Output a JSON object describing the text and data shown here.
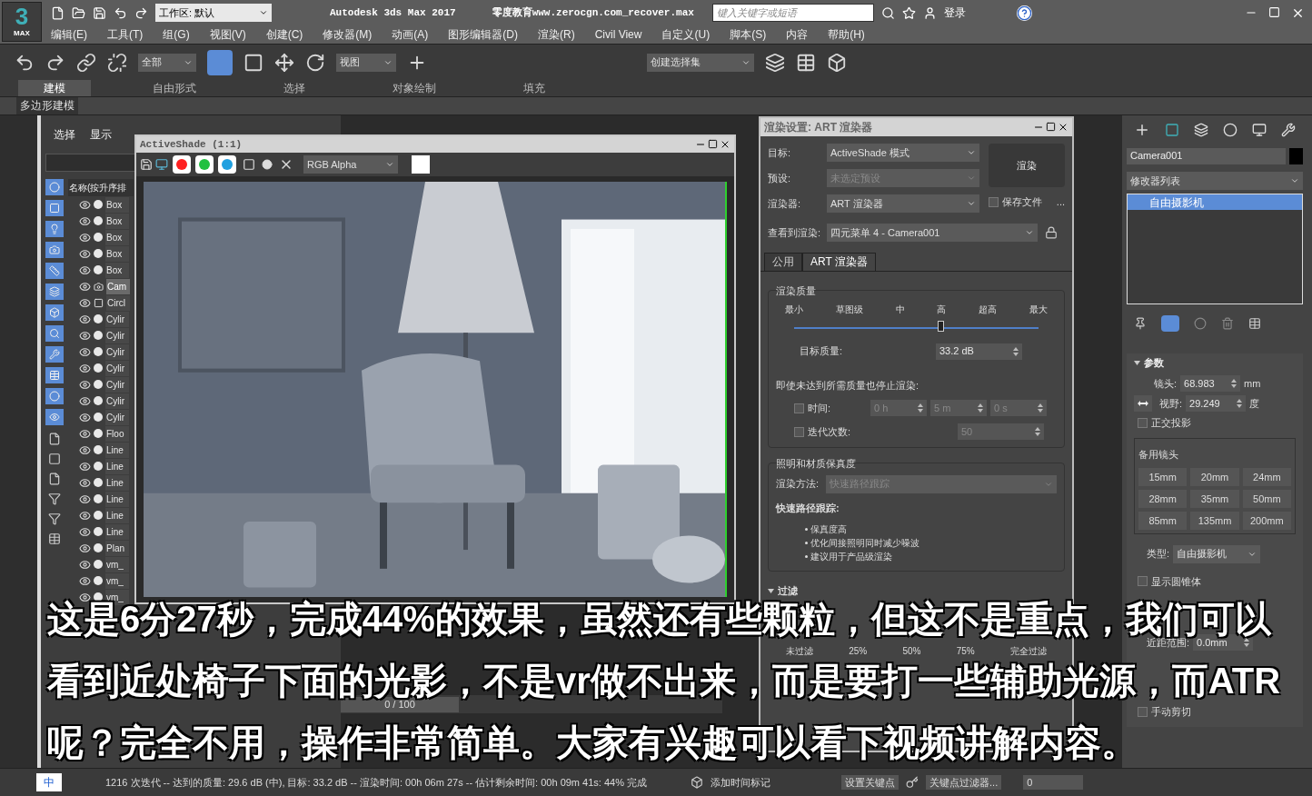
{
  "app": {
    "logo": "3",
    "logo_sub": "MAX",
    "workspace": "工作区: 默认",
    "title": "Autodesk 3ds Max 2017",
    "file": "零度教育www.zerocgn.com_recover.max",
    "search_placeholder": "键入关键字或短语",
    "login": "登录"
  },
  "menu": [
    "编辑(E)",
    "工具(T)",
    "组(G)",
    "视图(V)",
    "创建(C)",
    "修改器(M)",
    "动画(A)",
    "图形编辑器(D)",
    "渲染(R)",
    "Civil View",
    "自定义(U)",
    "脚本(S)",
    "内容",
    "帮助(H)"
  ],
  "toolbar": {
    "filter": "全部",
    "coord": "视图",
    "selection_set": "创建选择集"
  },
  "ribbon": {
    "tabs": [
      {
        "label": "建模",
        "selected": true
      },
      {
        "label": "自由形式",
        "selected": false
      },
      {
        "label": "选择",
        "selected": false
      },
      {
        "label": "对象绘制",
        "selected": false
      },
      {
        "label": "填充",
        "selected": false
      }
    ],
    "panel": "多边形建模"
  },
  "explorer": {
    "menu": [
      "选择",
      "显示"
    ],
    "header": "名称(按升序排",
    "rows": [
      {
        "name": "Box",
        "kind": "geometry",
        "selected": false
      },
      {
        "name": "Box",
        "kind": "geometry",
        "selected": false
      },
      {
        "name": "Box",
        "kind": "geometry",
        "selected": false
      },
      {
        "name": "Box",
        "kind": "geometry",
        "selected": false
      },
      {
        "name": "Box",
        "kind": "geometry",
        "selected": false
      },
      {
        "name": "Cam",
        "kind": "camera",
        "selected": true
      },
      {
        "name": "Circl",
        "kind": "shape",
        "selected": false
      },
      {
        "name": "Cylir",
        "kind": "geometry",
        "selected": false
      },
      {
        "name": "Cylir",
        "kind": "geometry",
        "selected": false
      },
      {
        "name": "Cylir",
        "kind": "geometry",
        "selected": false
      },
      {
        "name": "Cylir",
        "kind": "geometry",
        "selected": false
      },
      {
        "name": "Cylir",
        "kind": "geometry",
        "selected": false
      },
      {
        "name": "Cylir",
        "kind": "geometry",
        "selected": false
      },
      {
        "name": "Cylir",
        "kind": "geometry",
        "selected": false
      },
      {
        "name": "Floo",
        "kind": "geometry",
        "selected": false
      },
      {
        "name": "Line",
        "kind": "geometry",
        "selected": false
      },
      {
        "name": "Line",
        "kind": "geometry",
        "selected": false
      },
      {
        "name": "Line",
        "kind": "geometry",
        "selected": false
      },
      {
        "name": "Line",
        "kind": "geometry",
        "selected": false
      },
      {
        "name": "Line",
        "kind": "geometry",
        "selected": false
      },
      {
        "name": "Line",
        "kind": "geometry",
        "selected": false
      },
      {
        "name": "Plan",
        "kind": "geometry",
        "selected": false
      },
      {
        "name": "vm_",
        "kind": "geometry",
        "selected": false
      },
      {
        "name": "vm_",
        "kind": "geometry",
        "selected": false
      },
      {
        "name": "vm_",
        "kind": "geometry",
        "selected": false
      }
    ]
  },
  "activeshade": {
    "title": "ActiveShade (1:1)",
    "channel": "RGB Alpha",
    "channels": [
      {
        "color": "#ff2020"
      },
      {
        "color": "#20c040"
      },
      {
        "color": "#20a0e0"
      }
    ]
  },
  "render_settings": {
    "title": "渲染设置: ART 渲染器",
    "fields": [
      {
        "label": "目标:",
        "value": "ActiveShade 模式",
        "disabled": false
      },
      {
        "label": "预设:",
        "value": "未选定预设",
        "disabled": true
      },
      {
        "label": "渲染器:",
        "value": "ART 渲染器",
        "disabled": false
      }
    ],
    "render_button": "渲染",
    "save_file": {
      "label": "保存文件",
      "checked": false
    },
    "more": "...",
    "view": {
      "label": "查看到渲染:",
      "value": "四元菜单 4 - Camera001"
    },
    "tabs": [
      {
        "label": "公用",
        "selected": false
      },
      {
        "label": "ART 渲染器",
        "selected": true
      }
    ],
    "quality": {
      "title": "渲染质量",
      "ticks": [
        "最小",
        "草图级",
        "中",
        "高",
        "超高",
        "最大"
      ],
      "level": 0.6,
      "target_label": "目标质量:",
      "target": "33.2 dB"
    },
    "stop": {
      "label": "即使未达到所需质量也停止渲染:",
      "time": {
        "label": "时间:",
        "checked": false,
        "values": [
          "0 h",
          "5 m",
          "0 s"
        ]
      },
      "iterations": {
        "label": "迭代次数:",
        "checked": false,
        "value": "50"
      }
    },
    "fidelity": {
      "title": "照明和材质保真度",
      "method_label": "渲染方法:",
      "method": "快速路径跟踪",
      "heading": "快速路径跟踪:",
      "bullets": [
        "保真度高",
        "优化间接照明同时减少噪波",
        "建议用于产品级渲染"
      ]
    },
    "filter": {
      "title": "过滤",
      "ticks": [
        "未过滤",
        "25%",
        "50%",
        "75%",
        "完全过滤"
      ]
    }
  },
  "command_panel": {
    "object_name": "Camera001",
    "modifier_list": "修改器列表",
    "stack": [
      {
        "label": "自由摄影机",
        "selected": true
      }
    ],
    "params_title": "参数",
    "lens_label": "镜头:",
    "lens": "68.983",
    "lens_unit": "mm",
    "fov_label": "视野:",
    "fov": "29.249",
    "fov_unit": "度",
    "ortho": {
      "label": "正交投影",
      "checked": false
    },
    "stock_title": "备用镜头",
    "stock": [
      "15mm",
      "20mm",
      "24mm",
      "28mm",
      "35mm",
      "50mm",
      "85mm",
      "135mm",
      "200mm"
    ],
    "type_label": "类型:",
    "type": "自由摄影机",
    "cone": {
      "label": "显示圆锥体",
      "checked": false
    },
    "near_label": "近距范围:",
    "near": "0.0mm",
    "manual_clip": {
      "label": "手动剪切",
      "checked": false
    }
  },
  "timeline": {
    "frame": "0 / 100",
    "level": 0
  },
  "status": {
    "ime": "中",
    "message": "1216 次迭代 -- 达到的质量: 29.6 dB (中), 目标: 33.2 dB -- 渲染时间: 00h 06m 27s -- 估计剩余时间: 00h 09m 41s: 44% 完成",
    "add_time_tag": "添加时间标记",
    "set_key": "设置关键点",
    "key_filters": "关键点过滤器...",
    "frame": "0"
  },
  "subtitles": [
    "这是6分27秒，完成44%的效果，虽然还有些颗粒，但这不是重点，我们可以",
    "看到近处椅子下面的光影，不是vr做不出来，而是要打一些辅助光源，而ATR",
    "呢？完全不用，操作非常简单。大家有兴趣可以看下视频讲解内容。"
  ]
}
